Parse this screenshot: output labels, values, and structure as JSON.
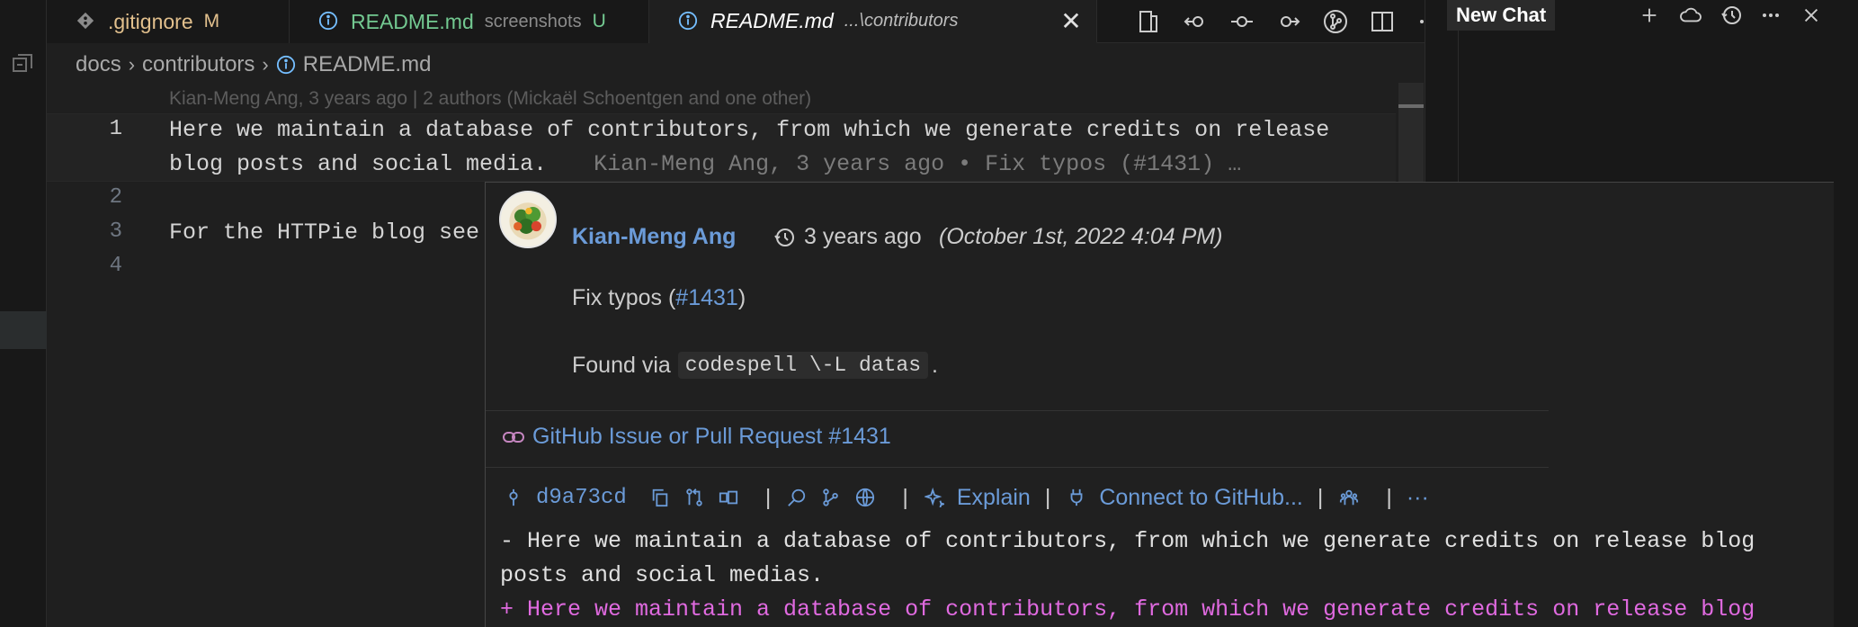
{
  "tabs": [
    {
      "label": ".gitignore",
      "description": "",
      "modifier": "M"
    },
    {
      "label": "README.md",
      "description": "screenshots",
      "modifier": "U"
    },
    {
      "label": "README.md",
      "description": "...\\contributors",
      "modifier": "",
      "close": "✕"
    }
  ],
  "breadcrumb": {
    "items": [
      "docs",
      "contributors",
      "README.md"
    ],
    "separator": "›"
  },
  "editor": {
    "codelens": "Kian-Meng Ang, 3 years ago | 2 authors (Mickaël Schoentgen and one other)",
    "line_numbers": [
      "1",
      "2",
      "3",
      "4"
    ],
    "line1a": "Here we maintain a database of contributors, from which we generate credits on release",
    "line1b": "blog posts and social media.",
    "blame": "Kian-Meng Ang, 3 years ago • Fix typos (#1431) …",
    "line3": "For the HTTPie blog see"
  },
  "chat": {
    "title": "New Chat",
    "actions": [
      "+",
      "cloud",
      "history",
      "more",
      "close"
    ]
  },
  "hover": {
    "author": "Kian-Meng Ang",
    "date_relative": "3 years ago",
    "date_absolute": "(October 1st, 2022 4:04 PM)",
    "message_prefix": "Fix typos (",
    "message_pr": "#1431",
    "message_suffix": ")",
    "body_prefix": "Found via",
    "body_code": "codespell \\-L datas",
    "body_suffix": ".",
    "issue_link": "GitHub Issue or Pull Request #1431",
    "sha": "d9a73cd",
    "explain": "Explain",
    "connect": "Connect to GitHub...",
    "more": "···",
    "diff": [
      "- Here we maintain a database of contributors, from which we generate credits on release blog",
      "posts and social medias.",
      "+ Here we maintain a database of contributors, from which we generate credits on release blog"
    ]
  },
  "colors": {
    "accent_link": "#6b9bd8",
    "added": "#e06ae0",
    "modified": "#e2c08d",
    "untracked": "#73c991"
  }
}
